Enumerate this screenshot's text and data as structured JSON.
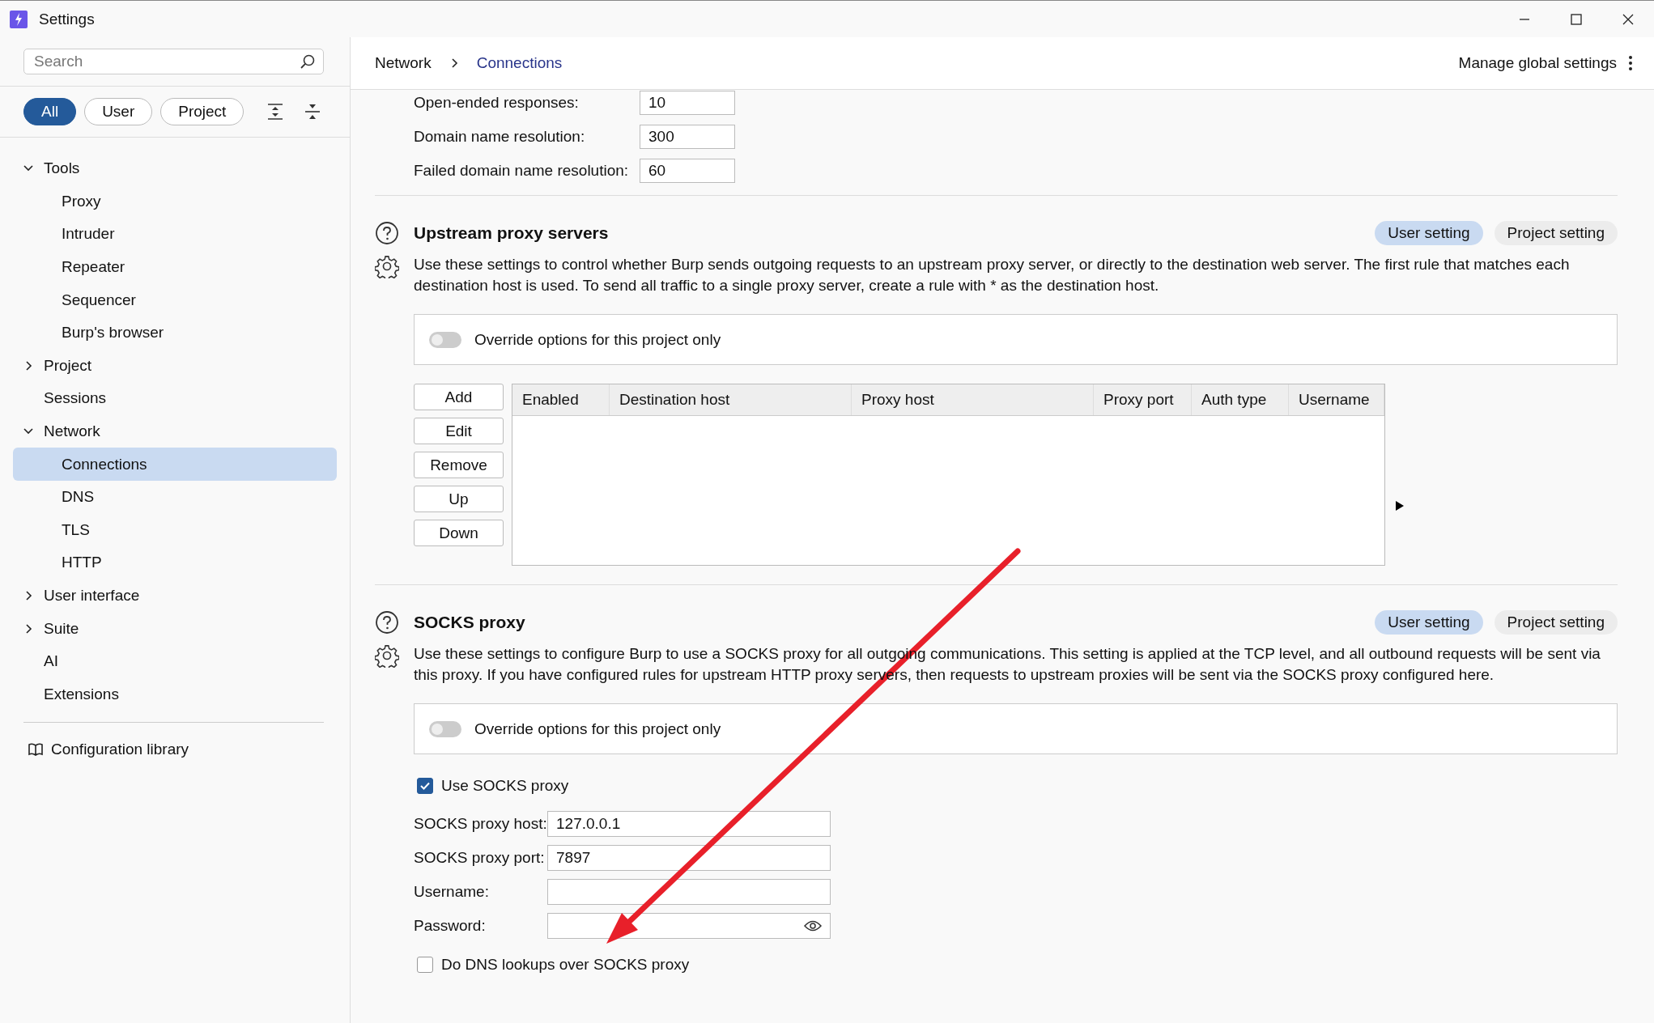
{
  "window": {
    "title": "Settings"
  },
  "sidebar": {
    "search": {
      "placeholder": "Search"
    },
    "filters": [
      {
        "label": "All",
        "selected": true
      },
      {
        "label": "User",
        "selected": false
      },
      {
        "label": "Project",
        "selected": false
      }
    ],
    "tree": [
      {
        "label": "Tools",
        "expanded": true,
        "selected": false,
        "children": [
          {
            "label": "Proxy",
            "selected": false
          },
          {
            "label": "Intruder",
            "selected": false
          },
          {
            "label": "Repeater",
            "selected": false
          },
          {
            "label": "Sequencer",
            "selected": false
          },
          {
            "label": "Burp's browser",
            "selected": false
          }
        ]
      },
      {
        "label": "Project",
        "expanded": false,
        "selected": false
      },
      {
        "label": "Sessions",
        "selected": false
      },
      {
        "label": "Network",
        "expanded": true,
        "selected": false,
        "children": [
          {
            "label": "Connections",
            "selected": true
          },
          {
            "label": "DNS",
            "selected": false
          },
          {
            "label": "TLS",
            "selected": false
          },
          {
            "label": "HTTP",
            "selected": false
          }
        ]
      },
      {
        "label": "User interface",
        "expanded": false,
        "selected": false
      },
      {
        "label": "Suite",
        "expanded": false,
        "selected": false
      },
      {
        "label": "AI",
        "selected": false
      },
      {
        "label": "Extensions",
        "selected": false
      }
    ],
    "footer_link": "Configuration library"
  },
  "header": {
    "breadcrumb": [
      "Network",
      "Connections"
    ],
    "manage": "Manage global settings"
  },
  "timeouts": [
    {
      "label": "Open-ended responses:",
      "value": "10"
    },
    {
      "label": "Domain name resolution:",
      "value": "300"
    },
    {
      "label": "Failed domain name resolution:",
      "value": "60"
    }
  ],
  "sections": [
    {
      "kind": "table",
      "title": "Upstream proxy servers",
      "scope_tabs": [
        {
          "label": "User setting",
          "selected": true
        },
        {
          "label": "Project setting",
          "selected": false
        }
      ],
      "description": "Use these settings to control whether Burp sends outgoing requests to an upstream proxy server, or directly to the destination web server. The first rule that matches each destination host is used. To send all traffic to a single proxy server, create a rule with * as the destination host.",
      "override": {
        "label": "Override options for this project only",
        "on": false
      },
      "buttons": [
        "Add",
        "Edit",
        "Remove",
        "Up",
        "Down"
      ],
      "table": {
        "columns": [
          "Enabled",
          "Destination host",
          "Proxy host",
          "Proxy port",
          "Auth type",
          "Username"
        ]
      }
    },
    {
      "kind": "socks",
      "title": "SOCKS proxy",
      "scope_tabs": [
        {
          "label": "User setting",
          "selected": true
        },
        {
          "label": "Project setting",
          "selected": false
        }
      ],
      "description": "Use these settings to configure Burp to use a SOCKS proxy for all outgoing communications. This setting is applied at the TCP level, and all outbound requests will be sent via this proxy. If you have configured rules for upstream HTTP proxy servers, then requests to upstream proxies will be sent via the SOCKS proxy configured here.",
      "override": {
        "label": "Override options for this project only",
        "on": false
      },
      "use_socks": {
        "label": "Use SOCKS proxy",
        "checked": true
      },
      "fields": [
        {
          "label": "SOCKS proxy host:",
          "value": "127.0.0.1",
          "kind": "text"
        },
        {
          "label": "SOCKS proxy port:",
          "value": "7897",
          "kind": "text"
        },
        {
          "label": "Username:",
          "kind": "text"
        },
        {
          "label": "Password:",
          "kind": "password"
        }
      ],
      "dns": {
        "label": "Do DNS lookups over SOCKS proxy",
        "checked": false
      }
    }
  ]
}
